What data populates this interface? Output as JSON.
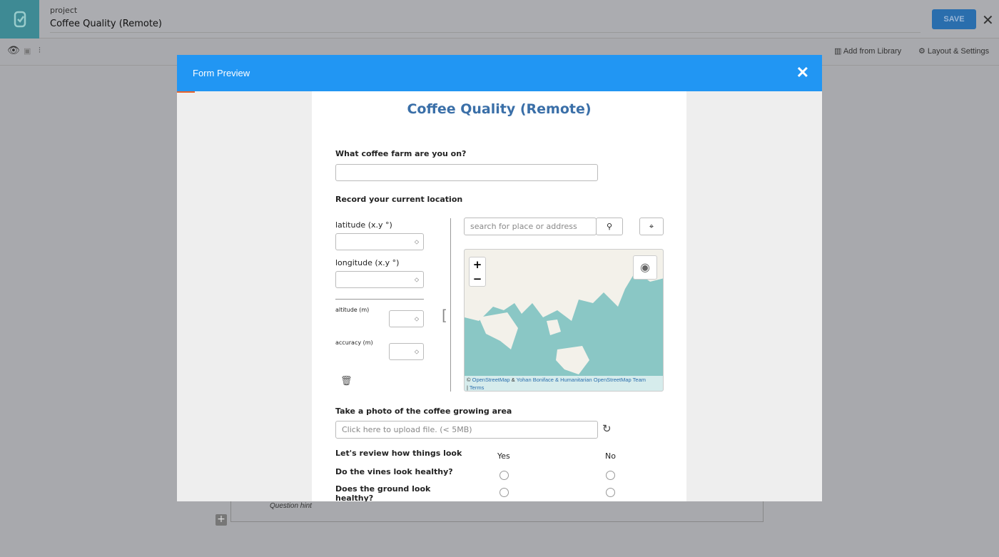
{
  "header": {
    "project_label": "project",
    "project_title": "Coffee Quality (Remote)",
    "save_label": "SAVE"
  },
  "toolbar": {
    "add_library": "Add from Library",
    "layout_settings": "Layout & Settings"
  },
  "background": {
    "question_hint": "Question hint"
  },
  "modal": {
    "title": "Form Preview"
  },
  "form": {
    "title": "Coffee Quality (Remote)",
    "q1": "What coffee farm are you on?",
    "q2": "Record your current location",
    "latitude": "latitude (x.y °)",
    "longitude": "longitude (x.y °)",
    "altitude": "altitude (m)",
    "accuracy": "accuracy (m)",
    "search_placeholder": "search for place or address",
    "attribution": {
      "copy": "©",
      "osm": "OpenStreetMap",
      "amp": "&",
      "yohan": "Yohan Boniface & Humanitarian OpenStreetMap Team",
      "sep": "|",
      "terms": "Terms"
    },
    "q3": "Take a photo of the coffee growing area",
    "upload_placeholder": "Click here to upload file. (< 5MB)",
    "matrix": {
      "header": "Let's review how things look",
      "columns": [
        "Yes",
        "No"
      ],
      "rows": [
        "Do the vines look healthy?",
        "Does the ground look healthy?"
      ]
    }
  },
  "colors": {
    "modal_header": "#2196f3",
    "title": "#3a6fa8",
    "map_water": "#8ac7c5",
    "logo": "#3e8a94"
  }
}
